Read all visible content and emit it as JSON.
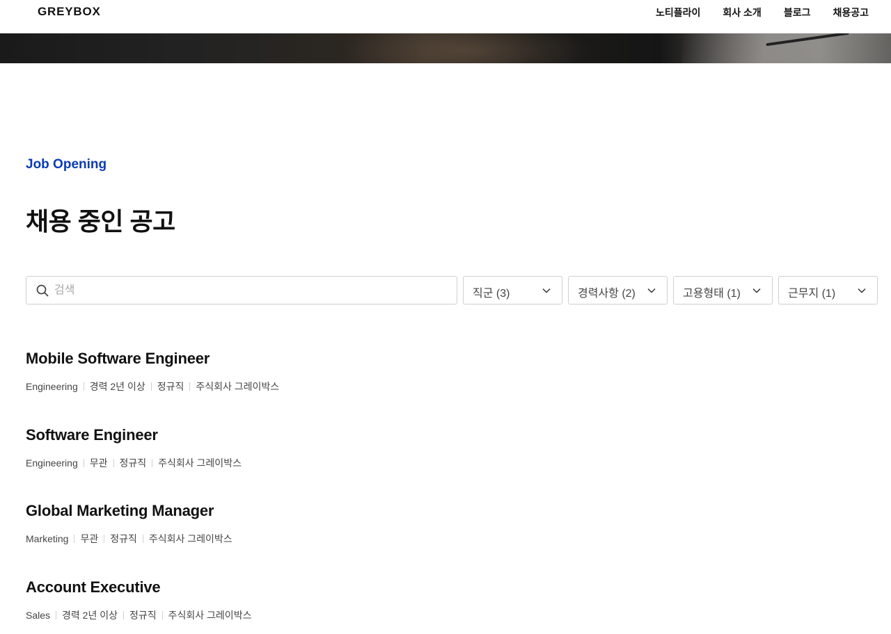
{
  "header": {
    "logo": "GREYBOX",
    "nav": [
      "노티플라이",
      "회사 소개",
      "블로그",
      "채용공고"
    ]
  },
  "section": {
    "eyebrow": "Job Opening",
    "title": "채용 중인 공고"
  },
  "search": {
    "placeholder": "검색",
    "value": ""
  },
  "filters": [
    "직군 (3)",
    "경력사항 (2)",
    "고용형태 (1)",
    "근무지 (1)"
  ],
  "jobs": [
    {
      "title": "Mobile Software Engineer",
      "category": "Engineering",
      "experience": "경력 2년 이상",
      "type": "정규직",
      "company": "주식회사 그레이박스"
    },
    {
      "title": "Software Engineer",
      "category": "Engineering",
      "experience": "무관",
      "type": "정규직",
      "company": "주식회사 그레이박스"
    },
    {
      "title": "Global Marketing Manager",
      "category": "Marketing",
      "experience": "무관",
      "type": "정규직",
      "company": "주식회사 그레이박스"
    },
    {
      "title": "Account Executive",
      "category": "Sales",
      "experience": "경력 2년 이상",
      "type": "정규직",
      "company": "주식회사 그레이박스"
    }
  ],
  "colors": {
    "accent": "#0b3bb5",
    "text": "#111111",
    "border": "#cfcfcf"
  },
  "icons": {
    "search": "search-icon",
    "dropdown": "chevron-down-icon"
  }
}
